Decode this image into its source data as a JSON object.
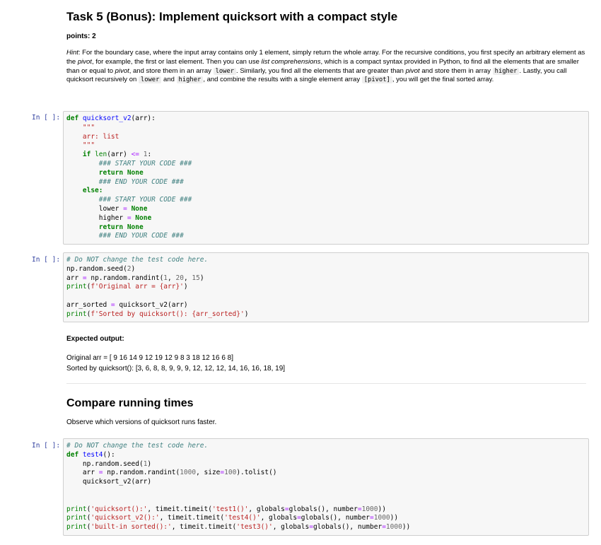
{
  "task": {
    "title": "Task 5 (Bonus): Implement quicksort with a compact style",
    "points": "points: 2",
    "hint": {
      "label": "Hint",
      "t1": ": For the boundary case, where the input array contains only 1 element, simply return the whole array. For the recursive conditions, you first specify an arbitrary element as the ",
      "pivot": "pivot",
      "t2": ", for example, the first or last element. Then you can use ",
      "lc": "list comprehensions",
      "t3": ", which is a compact syntax provided in Python, to find all the elements that are smaller than or equal to ",
      "t4": ", and store them in an array ",
      "lower": "lower",
      "t5": ". Similarly, you find all the elements that are greater than ",
      "t6": " and store them in array ",
      "higher": "higher",
      "t7": ". Lastly, you call quicksort recursively on ",
      "and": "and",
      "t8": ", and combine the results with a single element array ",
      "pivotarr": "[pivot]",
      "t9": ", you will get the final sorted array."
    }
  },
  "cells": {
    "prompt": "In [ ]:",
    "c1": {
      "l1_kw": "def",
      "l1_fn": "quicksort_v2",
      "l1_rest": "(arr):",
      "doc_open": "\"\"\"",
      "doc_body": "arr: list",
      "doc_close": "\"\"\"",
      "if_kw": "if",
      "len_fn": "len",
      "if_rest1": "(arr) ",
      "le": "<=",
      "one": "1",
      "colon": ":",
      "start_cm": "### START YOUR CODE ###",
      "return_kw": "return",
      "none_kw": "None",
      "end_cm": "### END YOUR CODE ###",
      "else_kw": "else:",
      "lower_var": "lower",
      "higher_var": "higher",
      "eq": "="
    },
    "c2": {
      "cm": "# Do NOT change the test code here.",
      "seed": "np.random.seed(",
      "seed_n": "2",
      "close": ")",
      "arr_assign": "arr ",
      "eq": "=",
      "randint": " np.random.randint(",
      "n1": "1",
      "comma": ", ",
      "n20": "20",
      "n15": "15",
      "print_fn": "print",
      "str1": "f'Original arr = {arr}'",
      "sorted_assign": "arr_sorted ",
      "qs_call": " quicksort_v2(arr)",
      "str2": "f'Sorted by quicksort(): {arr_sorted}'"
    },
    "c3": {
      "cm": "# Do NOT change the test code here.",
      "def_kw": "def",
      "fn": "test4",
      "fn_rest": "():",
      "seed": "np.random.seed(",
      "seed_n": "1",
      "close": ")",
      "arr_assign": "arr ",
      "eq": "=",
      "randint": " np.random.randint(",
      "n1000": "1000",
      "size": ", size",
      "n100": "100",
      "tolist": ").tolist()",
      "qs_call": "quicksort_v2(arr)",
      "print_fn": "print",
      "p1_str": "'quicksort():'",
      "p1_t": ", timeit.timeit(",
      "p1_s": "'test1()'",
      "p2_str": "'quicksort_v2():'",
      "p2_s": "'test4()'",
      "p3_str": "'built-in sorted():'",
      "p3_s": "'test3()'",
      "glob": ", globals",
      "glob2": "globals(), number",
      "n1000b": "1000",
      "end": "))"
    }
  },
  "expected": {
    "label": "Expected output:",
    "line1": "Original arr = [ 9 16 14 9 12 19 12 9 8 3 18 12 16 6 8]",
    "line2": "Sorted by quicksort(): [3, 6, 8, 8, 9, 9, 9, 12, 12, 12, 14, 16, 16, 18, 19]"
  },
  "compare": {
    "title": "Compare running times",
    "desc": "Observe which versions of quicksort runs faster."
  }
}
